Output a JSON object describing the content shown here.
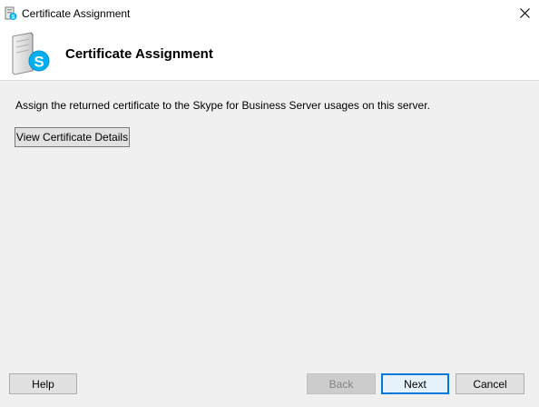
{
  "window": {
    "title": "Certificate Assignment"
  },
  "header": {
    "title": "Certificate Assignment"
  },
  "main": {
    "description": "Assign the returned certificate to the Skype for Business Server usages on this server.",
    "view_details_label": "View Certificate Details"
  },
  "footer": {
    "help_label": "Help",
    "back_label": "Back",
    "next_label": "Next",
    "cancel_label": "Cancel",
    "back_enabled": false
  },
  "icons": {
    "app": "skype-server-icon",
    "logo": "skype-for-business-server-logo",
    "close": "close-icon"
  },
  "colors": {
    "skype_blue": "#00aff0",
    "accent": "#0078d7",
    "dialog_bg": "#f0f0f0"
  }
}
